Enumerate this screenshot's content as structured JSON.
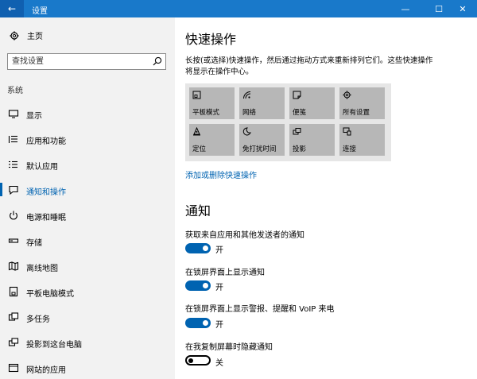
{
  "window": {
    "title": "设置",
    "back_glyph": "←",
    "minimize_glyph": "—",
    "maximize_glyph": "☐",
    "close_glyph": "✕",
    "titlebar_color": "#1979ca",
    "accent": "#0063b1"
  },
  "sidebar": {
    "home_label": "主页",
    "search_placeholder": "查找设置",
    "section_label": "系统",
    "items": [
      {
        "label": "显示",
        "icon": "monitor-icon"
      },
      {
        "label": "应用和功能",
        "icon": "list-icon"
      },
      {
        "label": "默认应用",
        "icon": "list-default-icon"
      },
      {
        "label": "通知和操作",
        "icon": "message-icon",
        "active": true
      },
      {
        "label": "电源和睡眠",
        "icon": "power-icon"
      },
      {
        "label": "存储",
        "icon": "storage-icon"
      },
      {
        "label": "离线地图",
        "icon": "map-icon"
      },
      {
        "label": "平板电脑模式",
        "icon": "tablet-icon"
      },
      {
        "label": "多任务",
        "icon": "multitask-icon"
      },
      {
        "label": "投影到这台电脑",
        "icon": "project-icon"
      },
      {
        "label": "网站的应用",
        "icon": "web-icon"
      }
    ]
  },
  "quick_actions": {
    "title": "快速操作",
    "description": "长按(或选择)快速操作，然后通过拖动方式来重新排列它们。这些快速操作将显示在操作中心。",
    "tiles": [
      {
        "label": "平板模式",
        "icon": "tablet-mode-icon"
      },
      {
        "label": "网络",
        "icon": "network-icon"
      },
      {
        "label": "便笺",
        "icon": "note-icon"
      },
      {
        "label": "所有设置",
        "icon": "gear-icon"
      },
      {
        "label": "定位",
        "icon": "location-icon"
      },
      {
        "label": "免打扰时间",
        "icon": "moon-icon"
      },
      {
        "label": "投影",
        "icon": "project-icon"
      },
      {
        "label": "连接",
        "icon": "connect-icon"
      }
    ],
    "edit_link": "添加或删除快速操作"
  },
  "notifications": {
    "title": "通知",
    "settings": [
      {
        "label": "获取来自应用和其他发送者的通知",
        "state": "开",
        "on": true
      },
      {
        "label": "在锁屏界面上显示通知",
        "state": "开",
        "on": true
      },
      {
        "label": "在锁屏界面上显示警报、提醒和 VoIP 来电",
        "state": "开",
        "on": true
      },
      {
        "label": "在我复制屏幕时隐藏通知",
        "state": "关",
        "on": false
      }
    ]
  }
}
